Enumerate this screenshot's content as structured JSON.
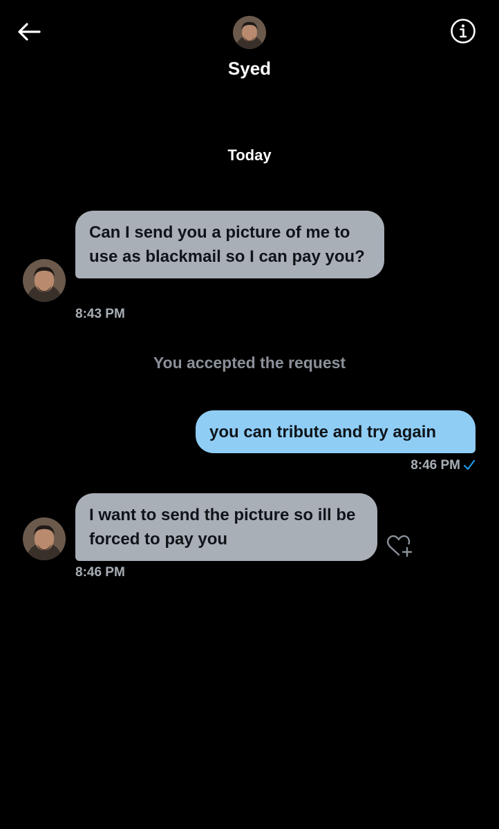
{
  "header": {
    "contact_name": "Syed",
    "back_icon": "arrow-left-icon",
    "info_icon": "info-icon"
  },
  "date_divider": "Today",
  "messages": [
    {
      "direction": "incoming",
      "text": "Can I send you a picture of me to use as blackmail so I can pay you?",
      "time": "8:43 PM"
    },
    {
      "direction": "system",
      "text": "You accepted the request"
    },
    {
      "direction": "outgoing",
      "text": "you can tribute and try again",
      "time": "8:46 PM",
      "status_icon": "check-icon"
    },
    {
      "direction": "incoming",
      "text": "I want to send the picture so ill be forced to pay you",
      "time": "8:46 PM",
      "reaction_icon": "heart-plus-icon"
    }
  ],
  "colors": {
    "background": "#000000",
    "incoming_bubble": "#a9afb7",
    "outgoing_bubble": "#8fcdf5",
    "accent": "#1d9bf0"
  }
}
